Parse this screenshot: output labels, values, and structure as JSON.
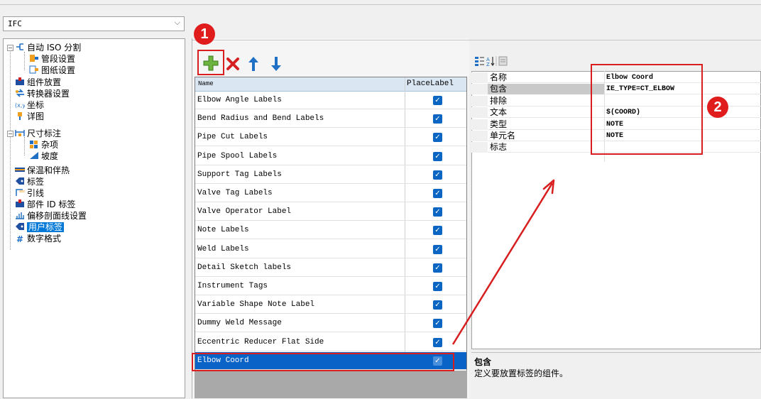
{
  "combo": {
    "value": "IFC"
  },
  "tree": {
    "items": [
      {
        "label": "自动 ISO 分割",
        "icon": "auto-split-icon",
        "level": 1
      },
      {
        "label": "管段设置",
        "icon": "pipe-segment-icon",
        "level": 2
      },
      {
        "label": "图纸设置",
        "icon": "drawing-settings-icon",
        "level": 2
      },
      {
        "label": "组件放置",
        "icon": "component-placement-icon",
        "level": 1
      },
      {
        "label": "转换器设置",
        "icon": "converter-icon",
        "level": 1
      },
      {
        "label": "坐标",
        "icon": "coordinate-icon",
        "level": 1
      },
      {
        "label": "详图",
        "icon": "detail-icon",
        "level": 1
      },
      {
        "label": "尺寸标注",
        "icon": "dimension-icon",
        "level": 1
      },
      {
        "label": "杂项",
        "icon": "misc-icon",
        "level": 2
      },
      {
        "label": "坡度",
        "icon": "slope-icon",
        "level": 2
      },
      {
        "label": "保温和伴热",
        "icon": "insulation-icon",
        "level": 1
      },
      {
        "label": "标签",
        "icon": "tag-icon",
        "level": 1
      },
      {
        "label": "引线",
        "icon": "leader-icon",
        "level": 1
      },
      {
        "label": "部件 ID 标签",
        "icon": "part-id-icon",
        "level": 1
      },
      {
        "label": "偏移剖面线设置",
        "icon": "offset-hatch-icon",
        "level": 1
      },
      {
        "label": "用户标签",
        "icon": "user-tag-icon",
        "level": 1,
        "selected": true
      },
      {
        "label": "数字格式",
        "icon": "number-format-icon",
        "level": 1
      }
    ]
  },
  "badges": {
    "one": "1",
    "two": "2"
  },
  "grid": {
    "col_name": "Name",
    "col_place": "PlaceLabel",
    "rows": [
      "Elbow Angle Labels",
      "Bend Radius and Bend Labels",
      "Pipe Cut Labels",
      "Pipe Spool Labels",
      "Support Tag Labels",
      "Valve Tag Labels",
      "Valve Operator Label",
      "Note Labels",
      "Weld Labels",
      "Detail Sketch labels",
      "Instrument Tags",
      "Variable Shape Note Label",
      "Dummy Weld Message",
      "Eccentric Reducer Flat Side",
      "Elbow Coord"
    ],
    "checkmark": "✓"
  },
  "props": {
    "rows": [
      {
        "k": "名称",
        "v": "Elbow Coord"
      },
      {
        "k": "包含",
        "v": "IE_TYPE=CT_ELBOW"
      },
      {
        "k": "排除",
        "v": ""
      },
      {
        "k": "文本",
        "v": "$(COORD)"
      },
      {
        "k": "类型",
        "v": "NOTE"
      },
      {
        "k": "单元名",
        "v": "NOTE"
      },
      {
        "k": "标志",
        "v": ""
      }
    ],
    "desc_title": "包含",
    "desc_text": "定义要放置标签的组件。"
  },
  "colors": {
    "accent": "#0a64c8",
    "annotation": "#d81e1e",
    "add": "#5aa02c",
    "delete": "#d42020",
    "arrow": "#1f6fc4"
  }
}
